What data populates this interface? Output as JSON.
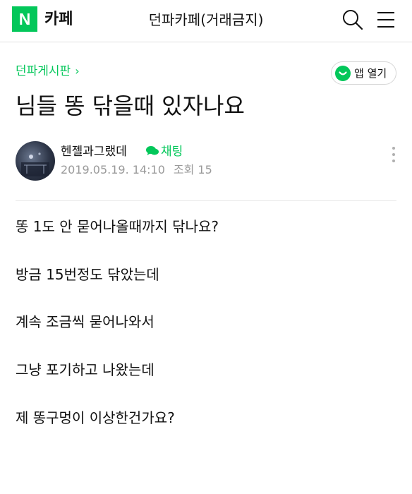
{
  "header": {
    "logo_letter": "N",
    "logo_text": "카페",
    "title": "던파카페(거래금지)",
    "icons": [
      "search-icon",
      "menu-icon"
    ]
  },
  "board": {
    "name": "던파게시판",
    "chevron": "›"
  },
  "open_app": {
    "label": "앱 열기",
    "icon": "naver-app-icon"
  },
  "post": {
    "title": "님들 똥 닦을때 있자나요",
    "author": "헨젤과그랬데",
    "chat_label": "채팅",
    "date": "2019.05.19. 14:10",
    "views": "조회 15",
    "body": [
      "똥 1도 안 묻어나올때까지 닦나요?",
      "방금 15번정도 닦았는데",
      "계속 조금씩 묻어나와서",
      "그냥 포기하고 나왔는데",
      "제 똥구멍이 이상한건가요?"
    ]
  },
  "colors": {
    "accent": "#03c75a",
    "text": "#111111",
    "meta": "#9a9a9a",
    "divider": "#e8e8e8"
  }
}
